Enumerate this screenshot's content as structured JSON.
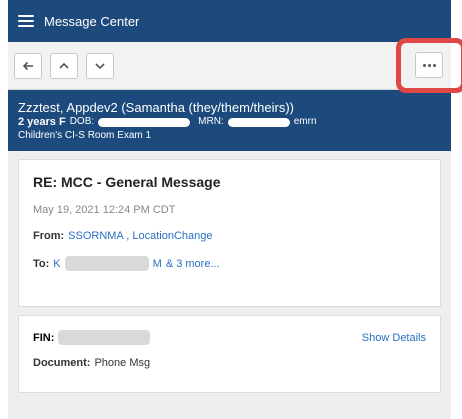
{
  "header": {
    "title": "Message Center",
    "menu_icon": "hamburger-menu-icon"
  },
  "toolbar": {
    "back_icon": "arrow-left-icon",
    "prev_icon": "chevron-up-icon",
    "next_icon": "chevron-down-icon",
    "more_icon": "ellipsis-icon"
  },
  "patient": {
    "name": "Zzztest, Appdev2 (Samantha (they/them/theirs))",
    "age_sex": "2 years F",
    "dob_label": "DOB:",
    "mrn_label": "MRN:",
    "mrn_suffix": "emrn",
    "location": "Children's CI-S Room Exam 1"
  },
  "message": {
    "subject": "RE: MCC - General Message",
    "date": "May 19, 2021 12:24 PM CDT",
    "from_label": "From:",
    "from_value": "SSORNMA , LocationChange",
    "to_label": "To:",
    "to_prefix": "K",
    "to_suffix": "M",
    "to_more": "& 3 more..."
  },
  "details": {
    "fin_label": "FIN:",
    "show_details": "Show Details",
    "document_label": "Document:",
    "document_value": "Phone Msg"
  },
  "colors": {
    "header_bg": "#1d4a7c",
    "link": "#2a6fc4",
    "highlight": "#e04848"
  }
}
